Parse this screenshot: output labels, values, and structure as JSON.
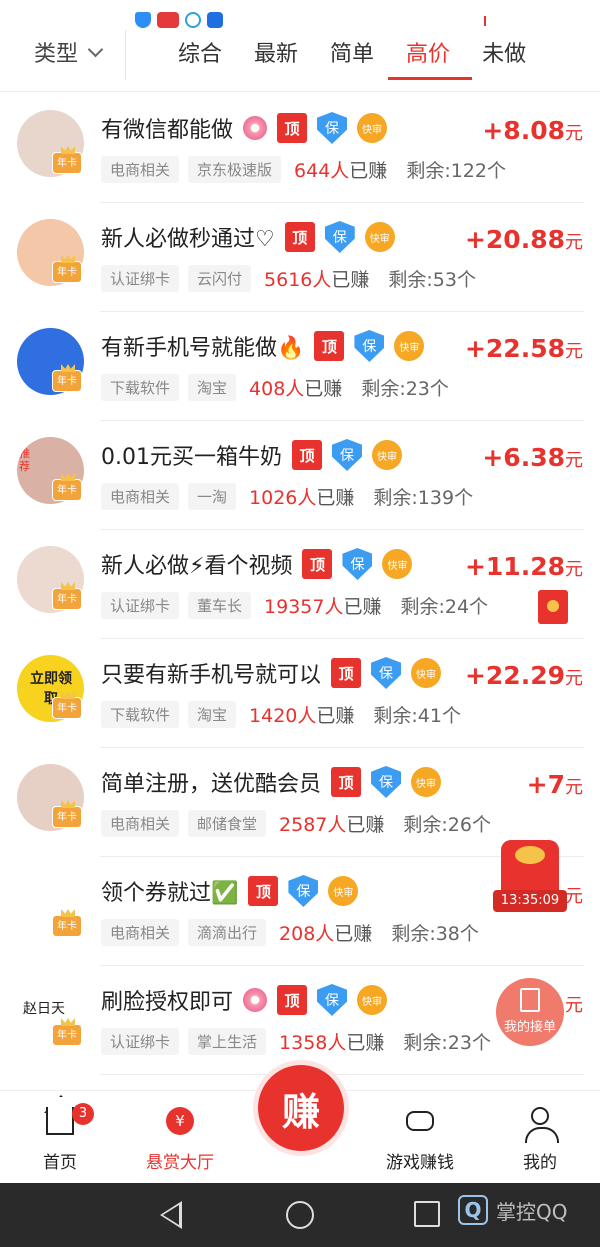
{
  "filter": {
    "type_label": "类型"
  },
  "tabs": [
    {
      "label": "综合"
    },
    {
      "label": "最新"
    },
    {
      "label": "简单"
    },
    {
      "label": "高价"
    },
    {
      "label": "未做"
    }
  ],
  "active_tab": "高价",
  "tags": {
    "top": "顶",
    "bao": "保",
    "fast": "快审",
    "year_card": "年卡"
  },
  "items": [
    {
      "title": "有微信都能做",
      "cat": "电商相关",
      "app": "京东极速版",
      "count": "644人",
      "earned_suffix": "已赚",
      "remain": "剩余:122个",
      "price": "+8.08",
      "unit": "元",
      "emoji": "flower"
    },
    {
      "title": "新人必做秒通过♡",
      "cat": "认证绑卡",
      "app": "云闪付",
      "count": "5616人",
      "earned_suffix": "已赚",
      "remain": "剩余:53个",
      "price": "+20.88",
      "unit": "元"
    },
    {
      "title": "有新手机号就能做🔥",
      "cat": "下载软件",
      "app": "淘宝",
      "count": "408人",
      "earned_suffix": "已赚",
      "remain": "剩余:23个",
      "price": "+22.58",
      "unit": "元"
    },
    {
      "title": "0.01元买一箱牛奶",
      "cat": "电商相关",
      "app": "一淘",
      "count": "1026人",
      "earned_suffix": "已赚",
      "remain": "剩余:139个",
      "price": "+6.38",
      "unit": "元"
    },
    {
      "title": "新人必做⚡看个视频",
      "cat": "认证绑卡",
      "app": "董车长",
      "count": "19357人",
      "earned_suffix": "已赚",
      "remain": "剩余:24个",
      "price": "+11.28",
      "unit": "元"
    },
    {
      "title": "只要有新手机号就可以",
      "cat": "下载软件",
      "app": "淘宝",
      "count": "1420人",
      "earned_suffix": "已赚",
      "remain": "剩余:41个",
      "price": "+22.29",
      "unit": "元"
    },
    {
      "title": "简单注册，送优酷会员",
      "cat": "电商相关",
      "app": "邮储食堂",
      "count": "2587人",
      "earned_suffix": "已赚",
      "remain": "剩余:26个",
      "price": "+7",
      "unit": "元"
    },
    {
      "title": "领个券就过✅",
      "cat": "电商相关",
      "app": "滴滴出行",
      "count": "208人",
      "earned_suffix": "已赚",
      "remain": "剩余:38个",
      "price": "",
      "unit": "元"
    },
    {
      "title": "刷脸授权即可",
      "cat": "认证绑卡",
      "app": "掌上生活",
      "count": "1358人",
      "earned_suffix": "已赚",
      "remain": "剩余:23个",
      "price": "",
      "unit": "元",
      "emoji": "flower"
    }
  ],
  "avatars": [
    {
      "color": "#e8d6cc"
    },
    {
      "color": "#f3c7a8"
    },
    {
      "color": "#2f6fe0"
    },
    {
      "color": "#d9b2a5"
    },
    {
      "color": "#ecd9cf"
    },
    {
      "color": "#f7d21f"
    },
    {
      "color": "#e6cfc4"
    },
    {
      "color": "#ffffff"
    },
    {
      "color": "#ffffff"
    }
  ],
  "avatar_texts": {
    "a4": "推荐",
    "a6": "立即领取",
    "a9": "赵日天"
  },
  "floating": {
    "timer": "13:35:09",
    "my_orders": "我的接单"
  },
  "tabbar": [
    {
      "label": "首页",
      "badge": "3"
    },
    {
      "label": "悬赏大厅",
      "icon_text": "¥"
    },
    {
      "label": "赚"
    },
    {
      "label": "游戏赚钱"
    },
    {
      "label": "我的"
    }
  ],
  "watermark": {
    "q": "Q",
    "text": "掌控QQ"
  },
  "colors": {
    "accent": "#e8322d",
    "bao": "#3b9cf2",
    "fast": "#f6a723"
  }
}
